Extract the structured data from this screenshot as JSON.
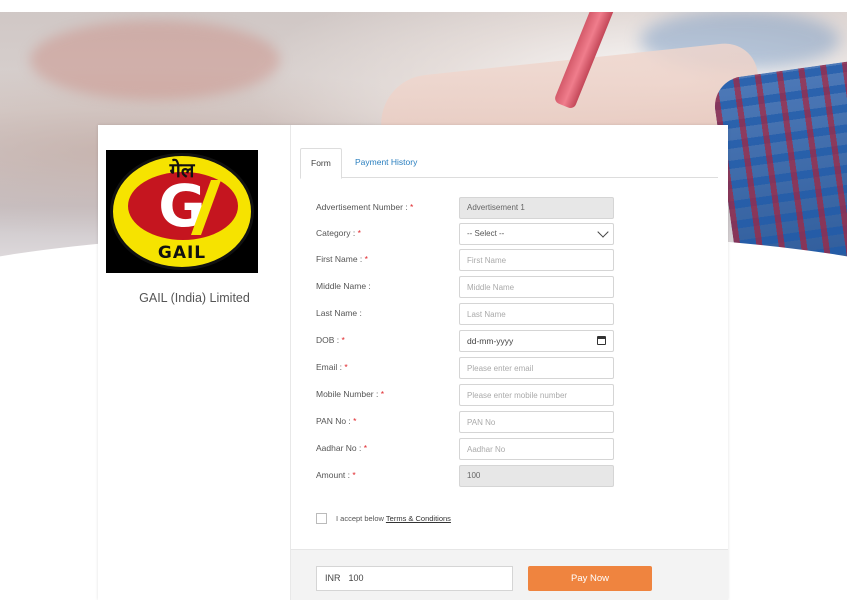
{
  "company": {
    "name": "GAIL (India) Limited",
    "logo_hindi": "गेल",
    "logo_text": "GAIL"
  },
  "tabs": [
    {
      "label": "Form",
      "active": true
    },
    {
      "label": "Payment History",
      "active": false
    }
  ],
  "form": {
    "advertisement_number": {
      "label": "Advertisement Number :",
      "value": "Advertisement 1",
      "required": true
    },
    "category": {
      "label": "Category :",
      "value": "-- Select --",
      "required": true
    },
    "first_name": {
      "label": "First Name :",
      "placeholder": "First Name",
      "required": true
    },
    "middle_name": {
      "label": "Middle Name :",
      "placeholder": "Middle Name",
      "required": false
    },
    "last_name": {
      "label": "Last Name :",
      "placeholder": "Last Name",
      "required": false
    },
    "dob": {
      "label": "DOB :",
      "placeholder": "dd-mm-yyyy",
      "required": true
    },
    "email": {
      "label": "Email :",
      "placeholder": "Please enter email",
      "required": true
    },
    "mobile": {
      "label": "Mobile Number :",
      "placeholder": "Please enter mobile number",
      "required": true
    },
    "pan": {
      "label": "PAN No :",
      "placeholder": "PAN No",
      "required": true
    },
    "aadhar": {
      "label": "Aadhar No :",
      "placeholder": "Aadhar No",
      "required": true
    },
    "amount": {
      "label": "Amount :",
      "value": "100",
      "required": true
    },
    "required_mark": "*"
  },
  "terms": {
    "prefix": "I accept below ",
    "link": "Terms & Conditions"
  },
  "footer": {
    "currency": "INR",
    "amount": "100",
    "pay_label": "Pay Now"
  },
  "colors": {
    "accent": "#ef843f",
    "link": "#2a7fbf",
    "required": "#e0262b"
  }
}
